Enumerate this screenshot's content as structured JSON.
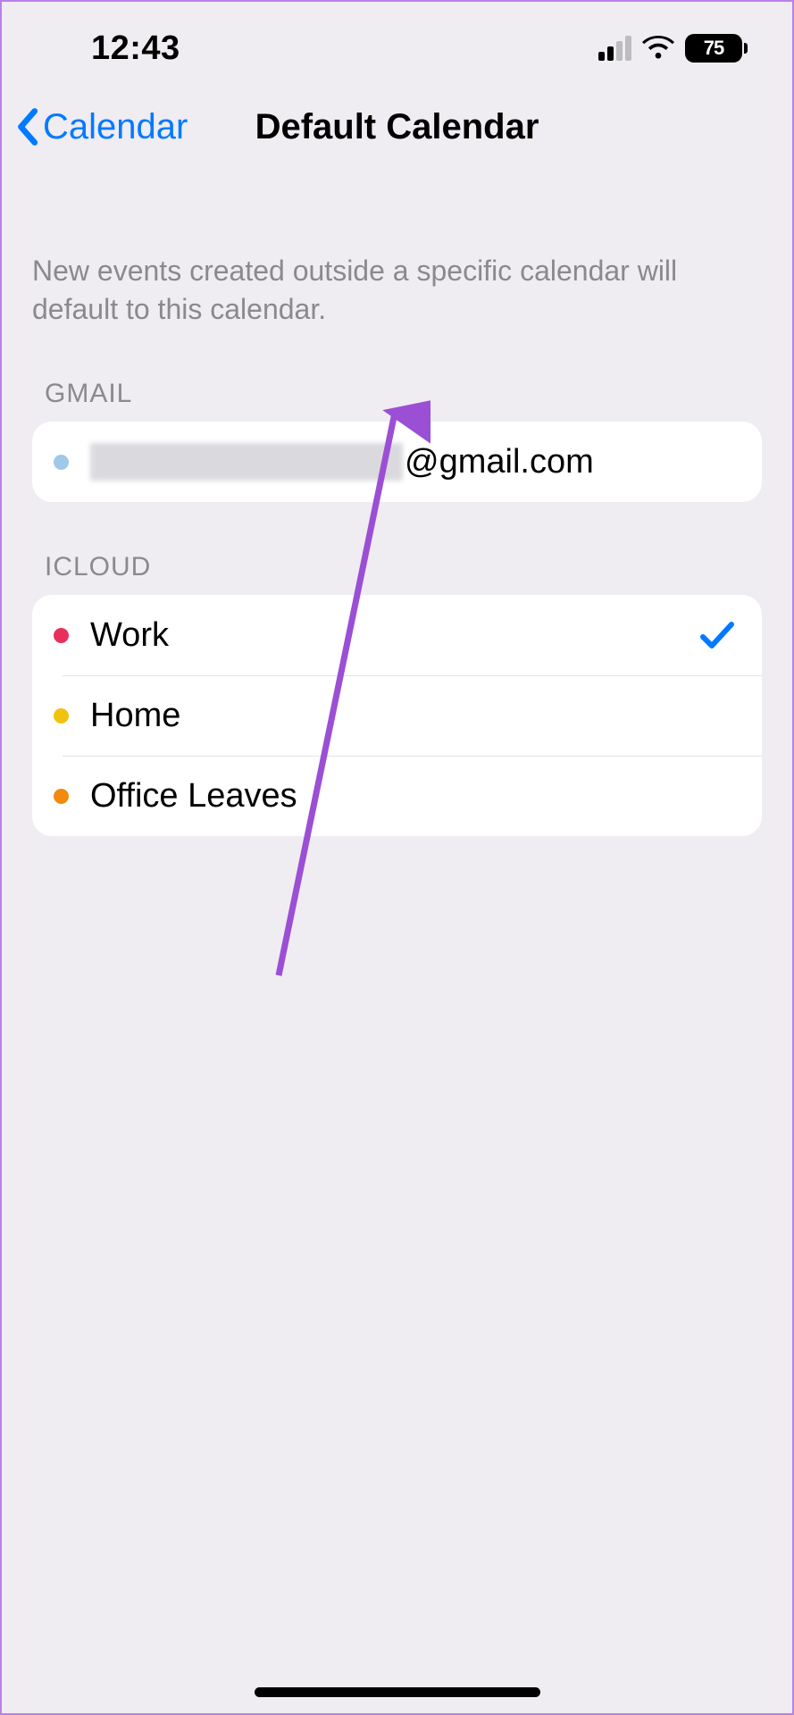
{
  "status": {
    "time": "12:43",
    "battery": "75"
  },
  "nav": {
    "back_label": "Calendar",
    "title": "Default Calendar"
  },
  "description": "New events created outside a specific calendar will default to this calendar.",
  "sections": [
    {
      "header": "GMAIL",
      "items": [
        {
          "label_suffix": "@gmail.com",
          "dot_color": "#9ec9e8",
          "selected": false,
          "redacted": true
        }
      ]
    },
    {
      "header": "ICLOUD",
      "items": [
        {
          "label": "Work",
          "dot_color": "#e8305a",
          "selected": true
        },
        {
          "label": "Home",
          "dot_color": "#f2c30d",
          "selected": false
        },
        {
          "label": "Office Leaves",
          "dot_color": "#f28a0d",
          "selected": false
        }
      ]
    }
  ],
  "colors": {
    "accent": "#007aff",
    "arrow": "#9b4fd4"
  }
}
